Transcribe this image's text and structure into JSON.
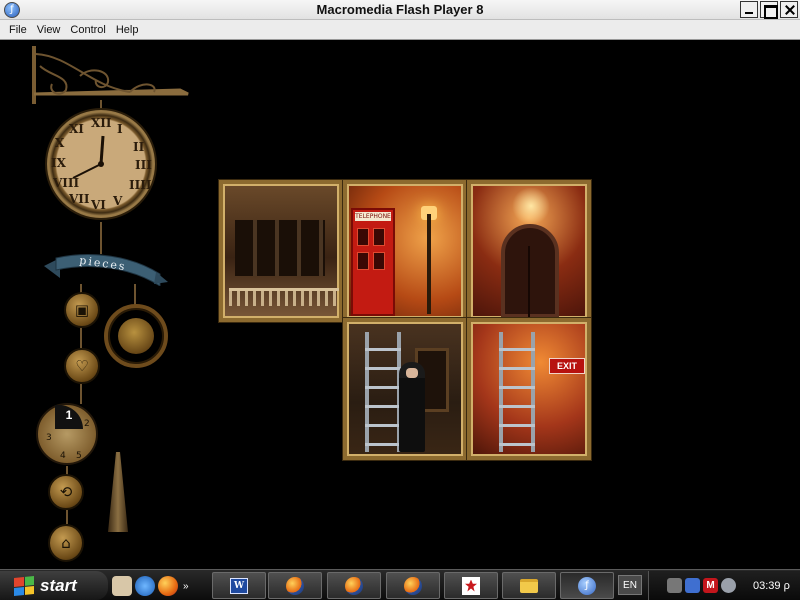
{
  "window": {
    "title": "Macromedia Flash Player 8",
    "icon": "flash-player-icon"
  },
  "menu": {
    "items": [
      "File",
      "View",
      "Control",
      "Help"
    ]
  },
  "game": {
    "pieces_label": "pieces",
    "clock_numerals": [
      "XII",
      "I",
      "II",
      "III",
      "IIII",
      "V",
      "VI",
      "VII",
      "VIII",
      "IX",
      "X",
      "XI"
    ],
    "dial_numbers": [
      "1",
      "2",
      "3",
      "4",
      "5"
    ],
    "dial_highlight": "1",
    "tiles": [
      {
        "scene": "building-balcony-scene"
      },
      {
        "scene": "telephone-booth-scene",
        "sign": "TELEPHONE"
      },
      {
        "scene": "arched-door-scene"
      },
      {
        "scene": "ladder-figure-scene"
      },
      {
        "scene": "ladder-exit-scene",
        "sign": "EXIT"
      }
    ]
  },
  "taskbar": {
    "start_label": "start",
    "quick_launch_more": "»",
    "language": "EN",
    "time": "03:39 ρ"
  },
  "colors": {
    "titlebar": "#e8e8e8",
    "menubar": "#ececec",
    "stage": "#000000",
    "frame_gold": "#8c6a2f",
    "taskbar": "#1a1a1a"
  }
}
